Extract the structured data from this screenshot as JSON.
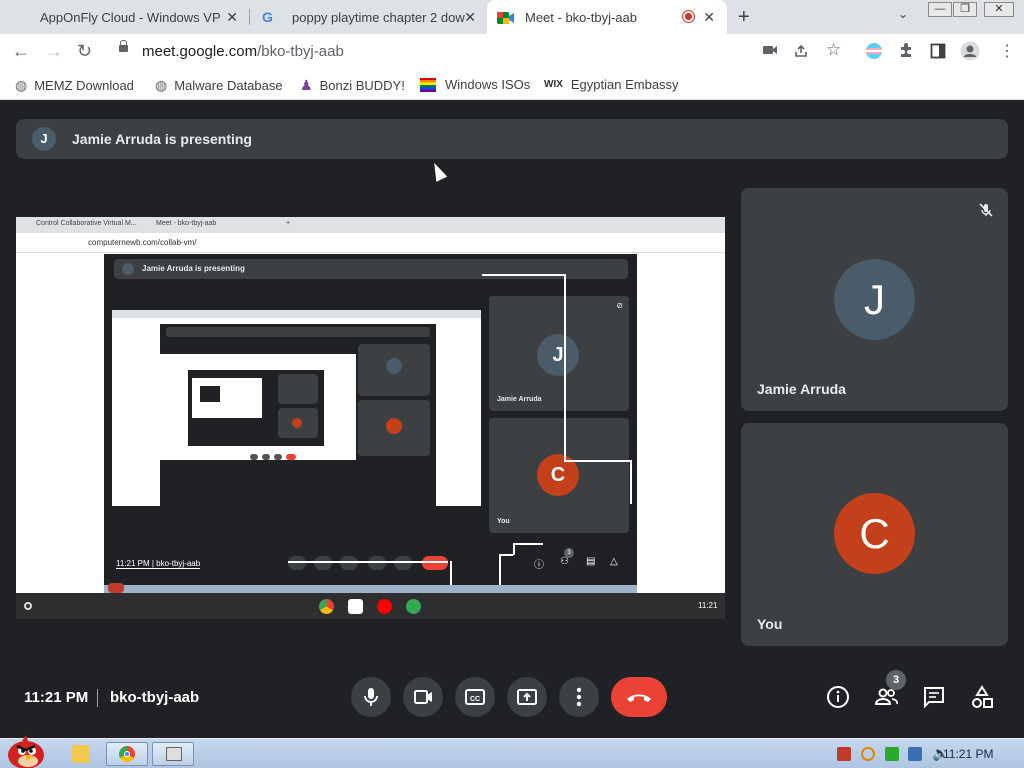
{
  "browser": {
    "tabs": [
      {
        "title": "AppOnFly Cloud - Windows VPS"
      },
      {
        "title": "poppy playtime chapter 2 dow"
      },
      {
        "title": "Meet - bko-tbyj-aab"
      }
    ],
    "url_host": "meet.google.com",
    "url_path": "/bko-tbyj-aab",
    "bookmarks": [
      {
        "label": "MEMZ Download"
      },
      {
        "label": "Malware Database"
      },
      {
        "label": "Bonzi BUDDY!"
      },
      {
        "label": "Windows ISOs"
      },
      {
        "label": "Egyptian Embassy"
      }
    ],
    "wix_label": "WIX"
  },
  "meet": {
    "presenter_initial": "J",
    "presenting_text": "Jamie Arruda is presenting",
    "shared_screen": {
      "tab1": "Control Collaborative Virtual M...",
      "tab2": "Meet - bko-tbyj-aab",
      "url": "computernewb.com/collab-vm/",
      "presenting_text": "Jamie Arruda is presenting",
      "tile1_initial": "J",
      "tile1_name": "Jamie Arruda",
      "tile2_initial": "C",
      "tile2_name": "You",
      "time_code": "11:21 PM  |  bko-tbyj-aab",
      "badge": "3",
      "shelf_time": "11:21"
    },
    "participants": [
      {
        "initial": "J",
        "name": "Jamie Arruda",
        "color": "#4a5b6a"
      },
      {
        "initial": "C",
        "name": "You",
        "color": "#c4401b"
      }
    ],
    "time": "11:21 PM",
    "meeting_code": "bko-tbyj-aab",
    "people_count": "3"
  },
  "taskbar": {
    "time": "11:21 PM"
  }
}
